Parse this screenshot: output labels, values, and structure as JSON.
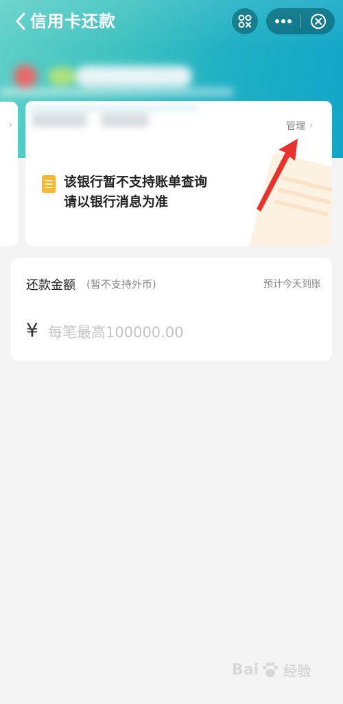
{
  "header": {
    "title": "信用卡还款",
    "back_icon": "chevron-left-icon",
    "scan_icon": "scan-icon",
    "more_icon": "more-dots-icon",
    "close_icon": "close-circle-icon"
  },
  "bank_card": {
    "manage_label": "管理",
    "notice_line1": "该银行暂不支持账单查询",
    "notice_line2": "请以银行消息为准"
  },
  "repayment": {
    "label": "还款金额",
    "sub_label": "(暂不支持外币)",
    "eta": "预计今天到账",
    "currency_symbol": "¥",
    "amount_value": "",
    "amount_placeholder": "每笔最高100000.00"
  },
  "watermark": {
    "text": "Bai",
    "suffix": "经验"
  },
  "colors": {
    "header_start": "#5fd0c8",
    "header_end": "#12a6c8",
    "arrow": "#e8322b",
    "notice_icon": "#f5b82e"
  }
}
